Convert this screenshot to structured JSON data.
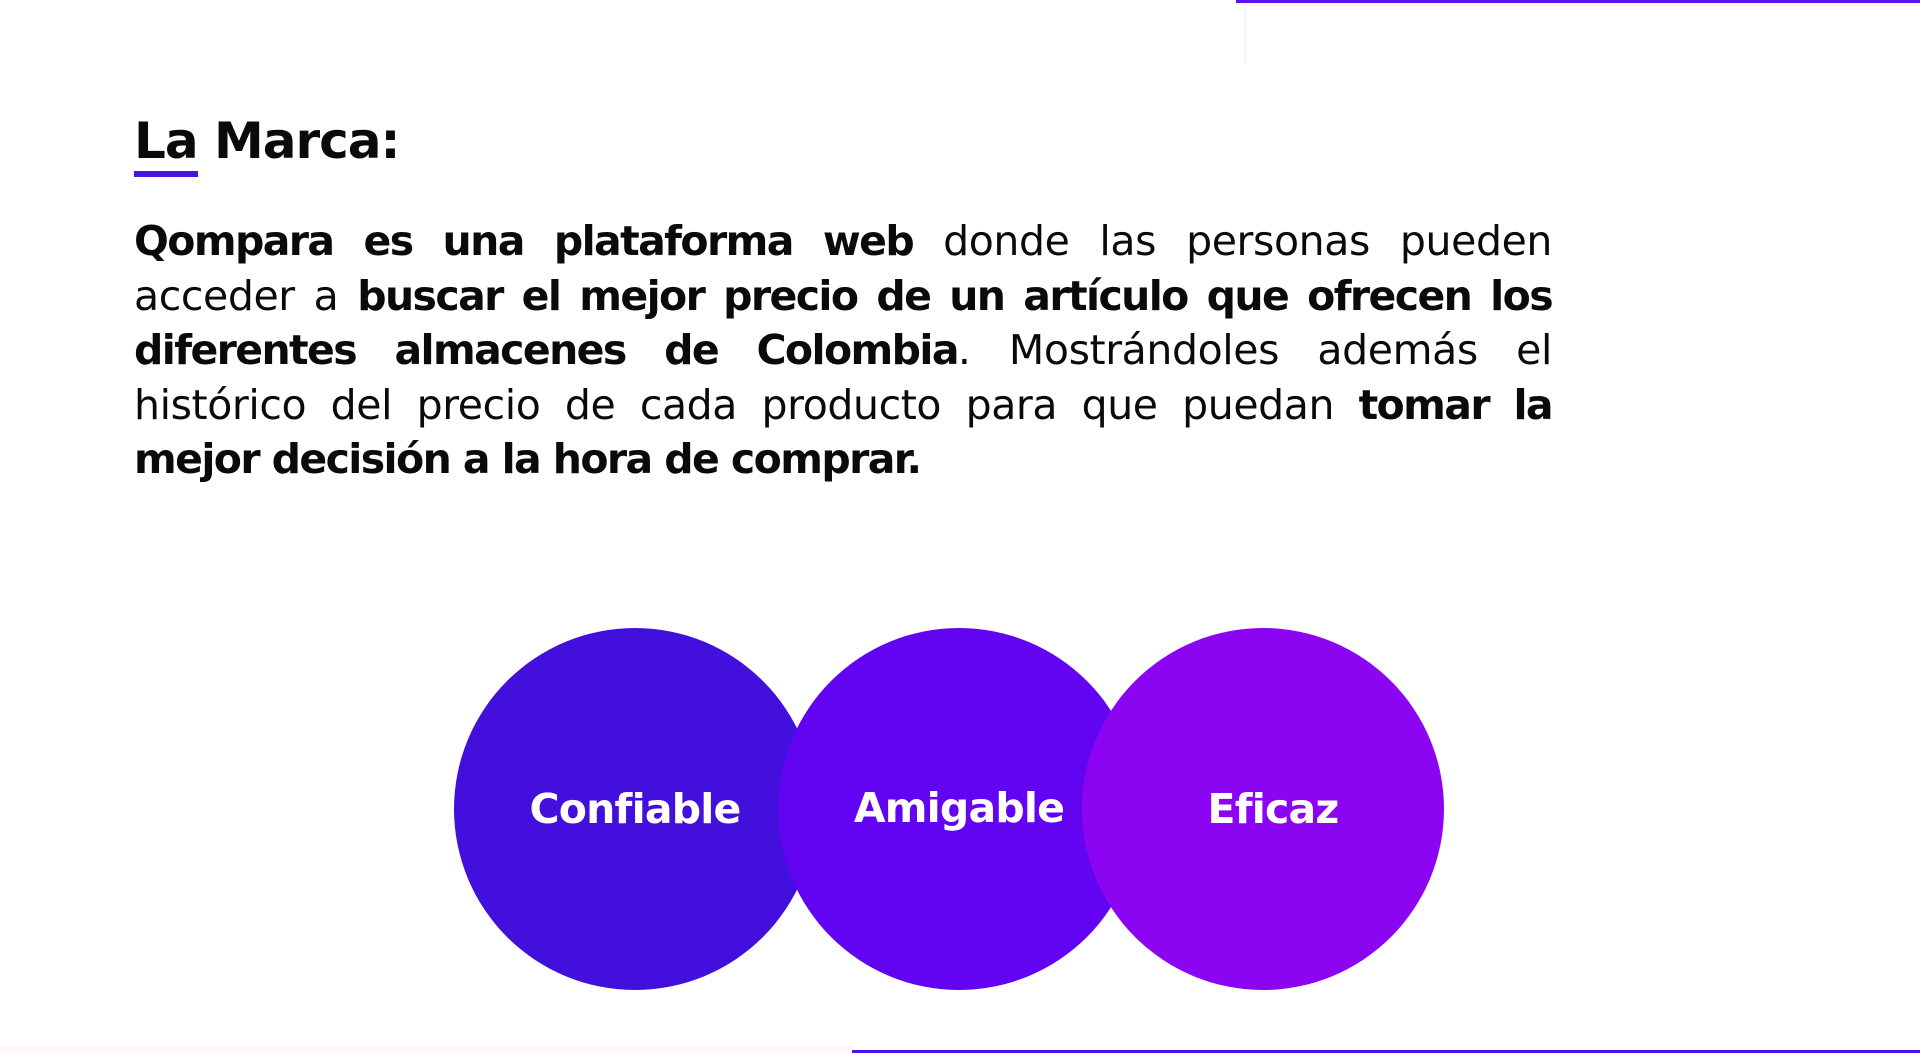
{
  "page": {
    "heading": {
      "underlined_part": "La",
      "rest": " Marca:"
    },
    "paragraph": {
      "s1_bold": "Qompara es una plataforma web",
      "s2": " donde las personas pueden acceder a ",
      "s3_bold": "buscar el mejor precio de un artículo que ofrecen los diferentes almacenes de Colombia",
      "s4": ". Mostrándoles además el histórico del precio de cada producto para que puedan ",
      "s5_bold": "tomar la mejor decisión a la hora de comprar."
    },
    "values": [
      {
        "label": "Confiable",
        "color": "#430fdc"
      },
      {
        "label": "Amigable",
        "color": "#6204f2"
      },
      {
        "label": "Eficaz",
        "color": "#8b05f3"
      }
    ]
  },
  "colors": {
    "accent_underline": "#4a14e0",
    "top_line": "#5b10f0",
    "bottom_line": "#4a10ea",
    "text": "#0a0a0a",
    "background": "#ffffff"
  }
}
